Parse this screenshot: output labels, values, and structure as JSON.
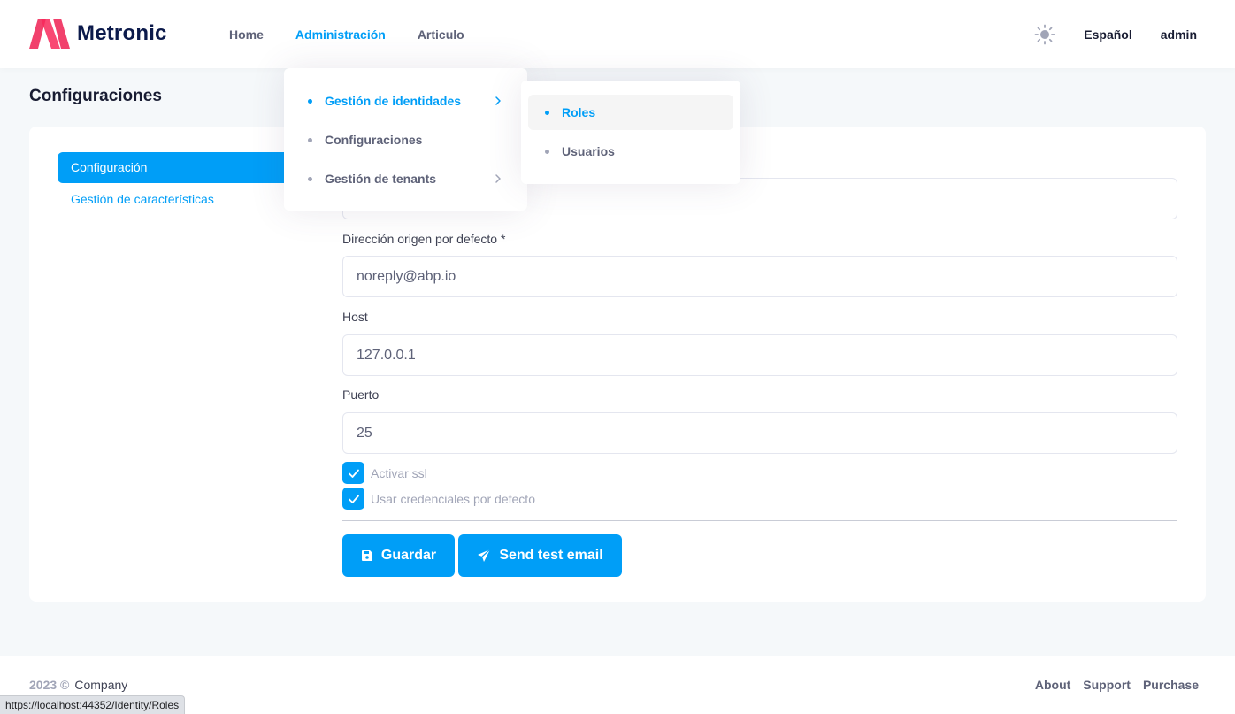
{
  "header": {
    "brand": "Metronic",
    "nav": [
      "Home",
      "Administración",
      "Articulo"
    ],
    "active_nav_index": 1,
    "language": "Español",
    "user": "admin"
  },
  "page": {
    "title": "Configuraciones"
  },
  "sidebar": {
    "items": [
      {
        "label": "Configuración",
        "active": true
      },
      {
        "label": "Gestión de características",
        "active": false
      }
    ]
  },
  "dropdown": {
    "main": [
      {
        "label": "Gestión de identidades",
        "active": true,
        "has_submenu": true
      },
      {
        "label": "Configuraciones",
        "active": false,
        "has_submenu": false
      },
      {
        "label": "Gestión de tenants",
        "active": false,
        "has_submenu": true
      }
    ],
    "sub": [
      {
        "label": "Roles",
        "active": true
      },
      {
        "label": "Usuarios",
        "active": false
      }
    ]
  },
  "form": {
    "fields": [
      {
        "label": "",
        "value": ""
      },
      {
        "label": "Dirección origen por defecto *",
        "value": "noreply@abp.io"
      },
      {
        "label": "Host",
        "value": "127.0.0.1"
      },
      {
        "label": "Puerto",
        "value": "25"
      }
    ],
    "checkboxes": [
      {
        "label": "Activar ssl",
        "checked": true
      },
      {
        "label": "Usar credenciales por defecto",
        "checked": true
      }
    ],
    "save_label": "Guardar",
    "test_label": "Send test email"
  },
  "footer": {
    "year": "2023 ©",
    "company": "Company",
    "links": [
      "About",
      "Support",
      "Purchase"
    ]
  },
  "status_url": "https://localhost:44352/Identity/Roles",
  "colors": {
    "primary": "#009ef7",
    "brand_pink": "#f1416c",
    "text_dark": "#181c32"
  }
}
